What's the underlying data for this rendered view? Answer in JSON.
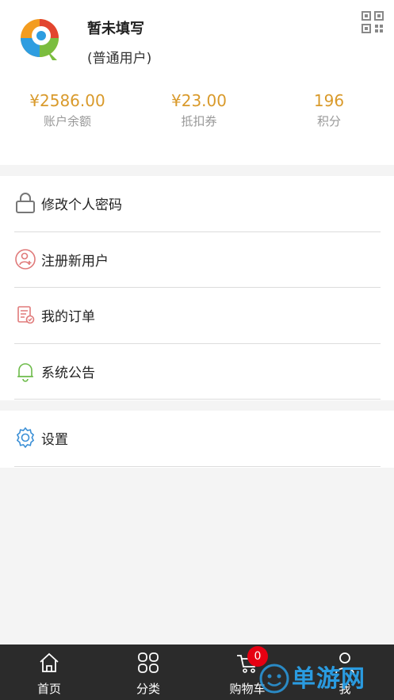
{
  "profile": {
    "name": "暂未填写",
    "role": "(普通用户)"
  },
  "stats": {
    "balance_value": "¥2586.00",
    "balance_label": "账户余额",
    "coupon_value": "¥23.00",
    "coupon_label": "抵扣券",
    "points_value": "196",
    "points_label": "积分"
  },
  "menu": {
    "items": [
      {
        "label": "修改个人密码",
        "icon": "lock-icon"
      },
      {
        "label": "注册新用户",
        "icon": "add-user-icon"
      },
      {
        "label": "我的订单",
        "icon": "order-icon"
      },
      {
        "label": "系统公告",
        "icon": "bell-icon"
      }
    ],
    "settings": {
      "label": "设置",
      "icon": "gear-icon"
    }
  },
  "tabbar": {
    "home": "首页",
    "category": "分类",
    "cart": "购物车",
    "me": "我",
    "cart_badge": "0"
  },
  "watermark": "单游网",
  "colors": {
    "accent": "#d99a2b",
    "badge": "#e60012",
    "tabbar_bg": "#2b2b2b",
    "watermark": "#2a9be0"
  }
}
